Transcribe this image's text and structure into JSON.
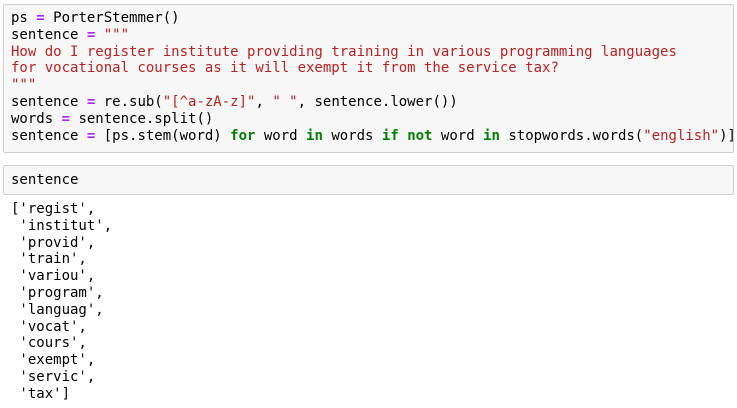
{
  "cell1": {
    "lines": [
      [
        {
          "t": "ps "
        },
        {
          "t": "=",
          "c": "op"
        },
        {
          "t": " PorterStemmer()"
        }
      ],
      [
        {
          "t": "sentence "
        },
        {
          "t": "=",
          "c": "op"
        },
        {
          "t": " "
        },
        {
          "t": "\"\"\"",
          "c": "str"
        }
      ],
      [
        {
          "t": "How do I register institute providing training in various programming languages",
          "c": "str"
        }
      ],
      [
        {
          "t": "for vocational courses as it will exempt it from the service tax?",
          "c": "str"
        }
      ],
      [
        {
          "t": "\"\"\"",
          "c": "str"
        }
      ],
      [
        {
          "t": "sentence "
        },
        {
          "t": "=",
          "c": "op"
        },
        {
          "t": " re.sub("
        },
        {
          "t": "\"[^a-zA-z]\"",
          "c": "str"
        },
        {
          "t": ", "
        },
        {
          "t": "\" \"",
          "c": "str"
        },
        {
          "t": ", sentence.lower())"
        }
      ],
      [
        {
          "t": "words "
        },
        {
          "t": "=",
          "c": "op"
        },
        {
          "t": " sentence.split()"
        }
      ],
      [
        {
          "t": "sentence "
        },
        {
          "t": "=",
          "c": "op"
        },
        {
          "t": " [ps.stem(word) "
        },
        {
          "t": "for",
          "c": "kw"
        },
        {
          "t": " word "
        },
        {
          "t": "in",
          "c": "kw"
        },
        {
          "t": " words "
        },
        {
          "t": "if",
          "c": "kw"
        },
        {
          "t": " "
        },
        {
          "t": "not",
          "c": "kw"
        },
        {
          "t": " word "
        },
        {
          "t": "in",
          "c": "kw"
        },
        {
          "t": " stopwords.words("
        },
        {
          "t": "\"english\"",
          "c": "str"
        },
        {
          "t": ")]"
        }
      ]
    ]
  },
  "cell2": {
    "code": "sentence"
  },
  "output": {
    "lines": [
      "['regist',",
      " 'institut',",
      " 'provid',",
      " 'train',",
      " 'variou',",
      " 'program',",
      " 'languag',",
      " 'vocat',",
      " 'cours',",
      " 'exempt',",
      " 'servic',",
      " 'tax']"
    ]
  }
}
